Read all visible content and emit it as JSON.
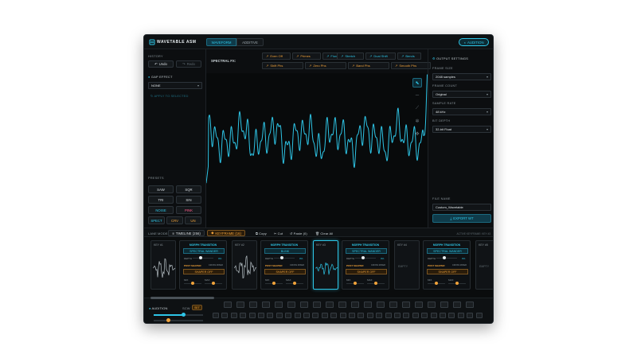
{
  "header": {
    "title": "WAVETABLE ASM",
    "tabs": [
      "WAVEFORM",
      "ADDITIVE"
    ],
    "audition": "AUDITION"
  },
  "left": {
    "history_label": "HISTORY",
    "undo": "Undo",
    "redo": "Redo",
    "gap_effect_label": "GAP EFFECT",
    "gap_select": "NONE",
    "apply_selected": "APPLY TO SELECTED",
    "presets_label": "PRESETS",
    "presets": [
      {
        "label": "SAW",
        "color": "#d8dee2"
      },
      {
        "label": "SQR",
        "color": "#d8dee2"
      },
      {
        "label": "TRI",
        "color": "#d8dee2"
      },
      {
        "label": "SIN",
        "color": "#d8dee2"
      },
      {
        "label": "NOISE",
        "color": "#2ec5e6"
      },
      {
        "label": "PINK",
        "color": "#ff5a8a"
      },
      {
        "label": "SPECT",
        "color": "#2ec5e6"
      },
      {
        "label": "CRV",
        "color": "#f0a23a"
      },
      {
        "label": "UN",
        "color": "#f0a23a"
      }
    ]
  },
  "fx": {
    "label": "SPECTRAL FX:",
    "row1": [
      "Even Off",
      "Primes",
      "Flux",
      "Stretch",
      "Dual Shift",
      "Bends"
    ],
    "row2": [
      "Shift Phs",
      "Zero Phs",
      "Band Phs",
      "Smooth Phs"
    ]
  },
  "right": {
    "section": "OUTPUT SETTINGS",
    "frame_size_label": "FRAME SIZE",
    "frame_size": "2048 samples",
    "frame_count_label": "FRAME COUNT",
    "frame_count": "Original",
    "sample_rate_label": "SAMPLE RATE",
    "sample_rate": "48 kHz",
    "bit_depth_label": "BIT DEPTH",
    "bit_depth": "32-bit Float",
    "file_name_label": "FILE NAME",
    "file_name": "Custom_Wavetable",
    "export": "EXPORT WT"
  },
  "timeline": {
    "lane_mode": "LANE MODE:",
    "timeline_btn": "TIMELINE (256)",
    "keyframe_btn": "KEYFRAME (16)",
    "copy": "Copy",
    "cut": "Cut",
    "paste": "Paste (0)",
    "clear": "Clear All",
    "status": "ACTIVE KEYFRAME: KEY #3"
  },
  "keys": [
    {
      "label": "KEY #1"
    },
    {
      "label": "KEY #2"
    },
    {
      "label": "KEY #3"
    },
    {
      "label": "KEY #4",
      "empty": "EMPTY"
    },
    {
      "label": "KEY #5",
      "empty": "EMPTY"
    }
  ],
  "transitions": [
    {
      "head": "MORPH TRANSITION",
      "mode": "SPECTRAL WANDER",
      "depth": "DEPTH",
      "depth_val": "0%",
      "shaper_head": "POST SHAPER",
      "shaper_hint": "CROSS MIXER",
      "shaper": "SHAPER OFF",
      "mix_a": "MIX",
      "mix_b": "MAX"
    },
    {
      "head": "MORPH TRANSITION",
      "mode": "BLINK",
      "depth": "DEPTH",
      "depth_val": "0%",
      "shaper_head": "POST SHAPER",
      "shaper_hint": "CROSS MIXER",
      "shaper": "SHAPER OFF",
      "mix_a": "MIX",
      "mix_b": "MAX"
    },
    {
      "head": "MORPH TRANSITION",
      "mode": "SPECTRAL WANDER",
      "depth": "DEPTH",
      "depth_val": "0%",
      "shaper_head": "POST SHAPER",
      "shaper_hint": "CROSS MIXER",
      "shaper": "SHAPER OFF",
      "mix_a": "MIX",
      "mix_b": "MAX"
    },
    {
      "head": "MORPH TRANSITION",
      "mode": "SPECTRAL WANDER",
      "depth": "DEPTH",
      "depth_val": "0%",
      "shaper_head": "POST SHAPER",
      "shaper_hint": "CROSS MIXER",
      "shaper": "SHAPER OFF",
      "mix_a": "MIX",
      "mix_b": "MAX"
    }
  ],
  "bottom": {
    "audition": "AUDITION",
    "scw": "SCW",
    "set": "SET"
  },
  "colors": {
    "accent": "#2ec5e6",
    "orange": "#f0a23a",
    "pink": "#ff5a8a"
  }
}
